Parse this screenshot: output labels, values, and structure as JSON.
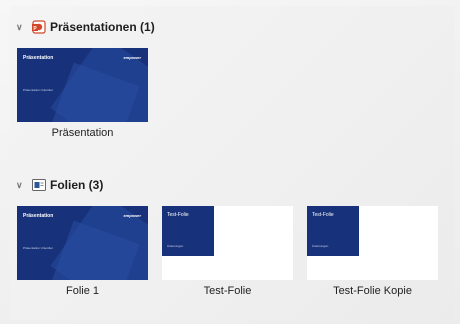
{
  "groups": [
    {
      "title": "Präsentationen (1)",
      "icon": "powerpoint-icon",
      "items": [
        {
          "caption": "Präsentation",
          "thumb_title": "Präsentation",
          "thumb_logo": "empower",
          "thumb_sub": "Präsentation Untertitel"
        }
      ]
    },
    {
      "title": "Folien (3)",
      "icon": "slides-icon",
      "items": [
        {
          "caption": "Folie 1",
          "thumb_title": "Präsentation",
          "thumb_logo": "empower",
          "thumb_sub": "Präsentation Untertitel"
        },
        {
          "caption": "Test-Folie",
          "thumb_title": "Test-Folie",
          "thumb_sub": "Änderungen"
        },
        {
          "caption": "Test-Folie Kopie",
          "thumb_title": "Test-Folie",
          "thumb_sub": "Änderungen"
        }
      ]
    }
  ],
  "colors": {
    "slide_blue": "#17317a",
    "ppt_orange": "#d24726"
  }
}
